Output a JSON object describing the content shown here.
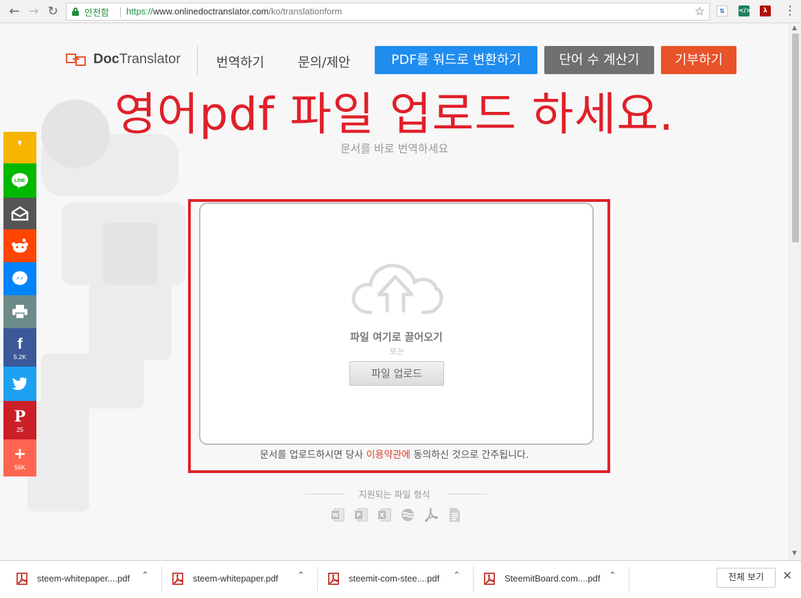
{
  "browser": {
    "secure_label": "안전함",
    "url_protocol": "https://",
    "url_host": "www.onlinedoctranslator.com",
    "url_path": "/ko/translationform"
  },
  "header": {
    "brand_bold": "Doc",
    "brand_rest": "Translator",
    "nav_translate": "번역하기",
    "nav_contact": "문의/제안",
    "btn_pdf_to_word": "PDF를 워드로 변환하기",
    "btn_word_count": "단어 수 계산기",
    "btn_donate": "기부하기",
    "colors": {
      "pdf_btn": "#1f8cf0",
      "count_btn": "#707070",
      "donate_btn": "#e8532a"
    }
  },
  "main": {
    "headline": "영어pdf 파일 업로드 하세요.",
    "subline": "문서를 바로 번역하세요",
    "drag_text": "파일 여기로 끌어오기",
    "or_text": "또는",
    "upload_button": "파일 업로드",
    "terms_before": "문서를 업로드하시면 당사 ",
    "terms_link": "이용약관에",
    "terms_after": " 동의하신 것으로 간주됩니다.",
    "formats_label": "지원되는 파일 형식",
    "format_icons": [
      "word-icon",
      "powerpoint-icon",
      "excel-icon",
      "opendocument-icon",
      "pdf-icon",
      "text-file-icon"
    ]
  },
  "share_bar": [
    {
      "name": "kakaostory",
      "color": "#f7b500",
      "count": ""
    },
    {
      "name": "line",
      "color": "#00b900",
      "count": ""
    },
    {
      "name": "email",
      "color": "#555555",
      "count": ""
    },
    {
      "name": "reddit",
      "color": "#ff4500",
      "count": ""
    },
    {
      "name": "messenger",
      "color": "#0084ff",
      "count": ""
    },
    {
      "name": "print",
      "color": "#6d8a8a",
      "count": ""
    },
    {
      "name": "facebook",
      "color": "#3b5998",
      "count": "5.2K"
    },
    {
      "name": "twitter",
      "color": "#1da1f2",
      "count": ""
    },
    {
      "name": "pinterest",
      "color": "#cb2027",
      "count": "25"
    },
    {
      "name": "more",
      "color": "#ff6550",
      "count": "56K"
    }
  ],
  "downloads": {
    "items": [
      "steem-whitepaper....pdf",
      "steem-whitepaper.pdf",
      "steemit-com-stee....pdf",
      "SteemitBoard.com....pdf"
    ],
    "show_all": "전체 보기"
  }
}
